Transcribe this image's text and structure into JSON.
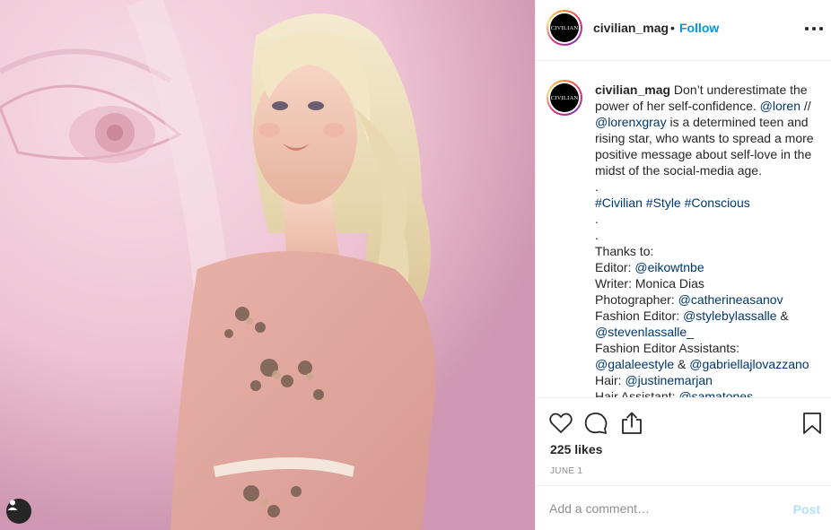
{
  "post": {
    "username": "civilian_mag",
    "avatar_text": "CIVILIAN",
    "separator": "•",
    "follow_label": "Follow",
    "caption": {
      "username": "civilian_mag",
      "text": " Don’t underestimate the power of her self-confidence. ",
      "mention_1": "@loren",
      "text_2": " // ",
      "mention_2": "@lorenxgray",
      "text_3": " is a determined teen and rising star, who wants to spread a more positive message about self-love in the midst of the social-media age.",
      "dot_1": ".",
      "hashtags": "#Civilian #Style #Conscious",
      "dot_2": ".",
      "dot_3": ".",
      "thanks": "Thanks to:",
      "credits": [
        {
          "role": "Editor: ",
          "handle": "@eikowtnbe"
        },
        {
          "role": "Writer: Monica Dias",
          "handle": ""
        },
        {
          "role": "Photographer: ",
          "handle": "@catherineasanov"
        },
        {
          "role": "Fashion Editor: ",
          "handle": "@stylebylassalle",
          "suffix": " &"
        },
        {
          "role": "",
          "handle": "@stevenlassalle_"
        },
        {
          "role": "Fashion Editor Assistants:",
          "handle": ""
        },
        {
          "role": "",
          "handle": "@galaleestyle",
          "suffix": " & ",
          "handle2": "@gabriellajlovazzano"
        },
        {
          "role": "Hair: ",
          "handle": "@justinemarjan"
        },
        {
          "role": "Hair Assistant: ",
          "handle": "@samatones"
        }
      ]
    },
    "likes": "225 likes",
    "date": "JUNE 1",
    "comment_placeholder": "Add a comment…",
    "post_label": "Post"
  },
  "icons": {
    "like": "heart-icon",
    "comment": "comment-icon",
    "share": "share-icon",
    "save": "bookmark-icon",
    "tags": "user-tag-icon",
    "more": "more-icon"
  },
  "colors": {
    "follow": "#0095f6",
    "mention": "#00376b",
    "post_disabled": "#b2dffc"
  }
}
